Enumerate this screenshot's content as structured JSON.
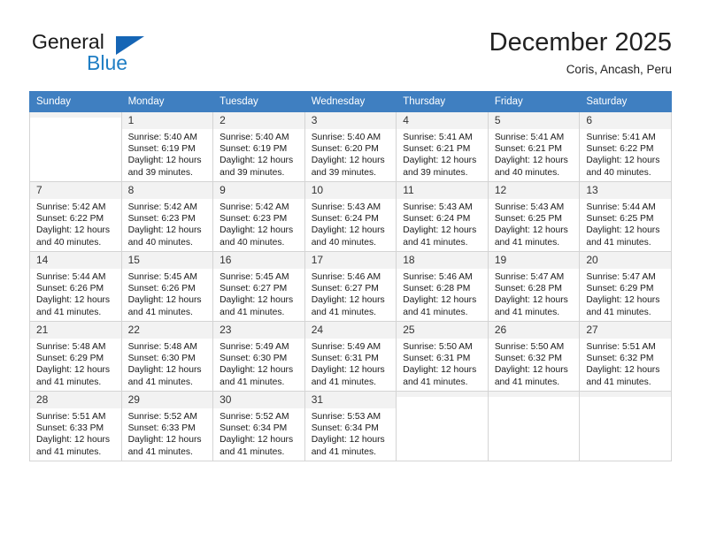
{
  "brand": {
    "name_top": "General",
    "name_bottom": "Blue",
    "accent_color": "#1f7ec4",
    "triangle_color": "#1565b5"
  },
  "header": {
    "title": "December 2025",
    "subtitle": "Coris, Ancash, Peru"
  },
  "calendar": {
    "header_bg": "#3f7fc1",
    "daynum_bg": "#f2f2f2",
    "weekday_headers": [
      "Sunday",
      "Monday",
      "Tuesday",
      "Wednesday",
      "Thursday",
      "Friday",
      "Saturday"
    ],
    "weeks": [
      [
        {
          "day": "",
          "sunrise": "",
          "sunset": "",
          "daylight": "",
          "empty": true
        },
        {
          "day": "1",
          "sunrise": "Sunrise: 5:40 AM",
          "sunset": "Sunset: 6:19 PM",
          "daylight": "Daylight: 12 hours and 39 minutes."
        },
        {
          "day": "2",
          "sunrise": "Sunrise: 5:40 AM",
          "sunset": "Sunset: 6:19 PM",
          "daylight": "Daylight: 12 hours and 39 minutes."
        },
        {
          "day": "3",
          "sunrise": "Sunrise: 5:40 AM",
          "sunset": "Sunset: 6:20 PM",
          "daylight": "Daylight: 12 hours and 39 minutes."
        },
        {
          "day": "4",
          "sunrise": "Sunrise: 5:41 AM",
          "sunset": "Sunset: 6:21 PM",
          "daylight": "Daylight: 12 hours and 39 minutes."
        },
        {
          "day": "5",
          "sunrise": "Sunrise: 5:41 AM",
          "sunset": "Sunset: 6:21 PM",
          "daylight": "Daylight: 12 hours and 40 minutes."
        },
        {
          "day": "6",
          "sunrise": "Sunrise: 5:41 AM",
          "sunset": "Sunset: 6:22 PM",
          "daylight": "Daylight: 12 hours and 40 minutes."
        }
      ],
      [
        {
          "day": "7",
          "sunrise": "Sunrise: 5:42 AM",
          "sunset": "Sunset: 6:22 PM",
          "daylight": "Daylight: 12 hours and 40 minutes."
        },
        {
          "day": "8",
          "sunrise": "Sunrise: 5:42 AM",
          "sunset": "Sunset: 6:23 PM",
          "daylight": "Daylight: 12 hours and 40 minutes."
        },
        {
          "day": "9",
          "sunrise": "Sunrise: 5:42 AM",
          "sunset": "Sunset: 6:23 PM",
          "daylight": "Daylight: 12 hours and 40 minutes."
        },
        {
          "day": "10",
          "sunrise": "Sunrise: 5:43 AM",
          "sunset": "Sunset: 6:24 PM",
          "daylight": "Daylight: 12 hours and 40 minutes."
        },
        {
          "day": "11",
          "sunrise": "Sunrise: 5:43 AM",
          "sunset": "Sunset: 6:24 PM",
          "daylight": "Daylight: 12 hours and 41 minutes."
        },
        {
          "day": "12",
          "sunrise": "Sunrise: 5:43 AM",
          "sunset": "Sunset: 6:25 PM",
          "daylight": "Daylight: 12 hours and 41 minutes."
        },
        {
          "day": "13",
          "sunrise": "Sunrise: 5:44 AM",
          "sunset": "Sunset: 6:25 PM",
          "daylight": "Daylight: 12 hours and 41 minutes."
        }
      ],
      [
        {
          "day": "14",
          "sunrise": "Sunrise: 5:44 AM",
          "sunset": "Sunset: 6:26 PM",
          "daylight": "Daylight: 12 hours and 41 minutes."
        },
        {
          "day": "15",
          "sunrise": "Sunrise: 5:45 AM",
          "sunset": "Sunset: 6:26 PM",
          "daylight": "Daylight: 12 hours and 41 minutes."
        },
        {
          "day": "16",
          "sunrise": "Sunrise: 5:45 AM",
          "sunset": "Sunset: 6:27 PM",
          "daylight": "Daylight: 12 hours and 41 minutes."
        },
        {
          "day": "17",
          "sunrise": "Sunrise: 5:46 AM",
          "sunset": "Sunset: 6:27 PM",
          "daylight": "Daylight: 12 hours and 41 minutes."
        },
        {
          "day": "18",
          "sunrise": "Sunrise: 5:46 AM",
          "sunset": "Sunset: 6:28 PM",
          "daylight": "Daylight: 12 hours and 41 minutes."
        },
        {
          "day": "19",
          "sunrise": "Sunrise: 5:47 AM",
          "sunset": "Sunset: 6:28 PM",
          "daylight": "Daylight: 12 hours and 41 minutes."
        },
        {
          "day": "20",
          "sunrise": "Sunrise: 5:47 AM",
          "sunset": "Sunset: 6:29 PM",
          "daylight": "Daylight: 12 hours and 41 minutes."
        }
      ],
      [
        {
          "day": "21",
          "sunrise": "Sunrise: 5:48 AM",
          "sunset": "Sunset: 6:29 PM",
          "daylight": "Daylight: 12 hours and 41 minutes."
        },
        {
          "day": "22",
          "sunrise": "Sunrise: 5:48 AM",
          "sunset": "Sunset: 6:30 PM",
          "daylight": "Daylight: 12 hours and 41 minutes."
        },
        {
          "day": "23",
          "sunrise": "Sunrise: 5:49 AM",
          "sunset": "Sunset: 6:30 PM",
          "daylight": "Daylight: 12 hours and 41 minutes."
        },
        {
          "day": "24",
          "sunrise": "Sunrise: 5:49 AM",
          "sunset": "Sunset: 6:31 PM",
          "daylight": "Daylight: 12 hours and 41 minutes."
        },
        {
          "day": "25",
          "sunrise": "Sunrise: 5:50 AM",
          "sunset": "Sunset: 6:31 PM",
          "daylight": "Daylight: 12 hours and 41 minutes."
        },
        {
          "day": "26",
          "sunrise": "Sunrise: 5:50 AM",
          "sunset": "Sunset: 6:32 PM",
          "daylight": "Daylight: 12 hours and 41 minutes."
        },
        {
          "day": "27",
          "sunrise": "Sunrise: 5:51 AM",
          "sunset": "Sunset: 6:32 PM",
          "daylight": "Daylight: 12 hours and 41 minutes."
        }
      ],
      [
        {
          "day": "28",
          "sunrise": "Sunrise: 5:51 AM",
          "sunset": "Sunset: 6:33 PM",
          "daylight": "Daylight: 12 hours and 41 minutes."
        },
        {
          "day": "29",
          "sunrise": "Sunrise: 5:52 AM",
          "sunset": "Sunset: 6:33 PM",
          "daylight": "Daylight: 12 hours and 41 minutes."
        },
        {
          "day": "30",
          "sunrise": "Sunrise: 5:52 AM",
          "sunset": "Sunset: 6:34 PM",
          "daylight": "Daylight: 12 hours and 41 minutes."
        },
        {
          "day": "31",
          "sunrise": "Sunrise: 5:53 AM",
          "sunset": "Sunset: 6:34 PM",
          "daylight": "Daylight: 12 hours and 41 minutes."
        },
        {
          "day": "",
          "sunrise": "",
          "sunset": "",
          "daylight": "",
          "empty": true
        },
        {
          "day": "",
          "sunrise": "",
          "sunset": "",
          "daylight": "",
          "empty": true
        },
        {
          "day": "",
          "sunrise": "",
          "sunset": "",
          "daylight": "",
          "empty": true
        }
      ]
    ]
  }
}
